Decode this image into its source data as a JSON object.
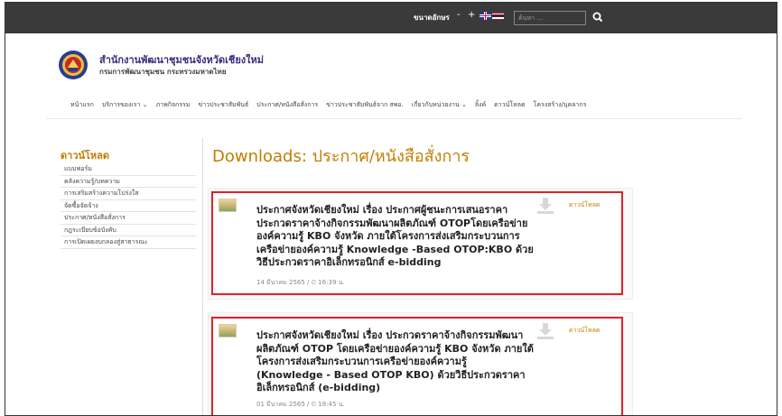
{
  "topbar": {
    "font_size_label": "ขนาดอักษร",
    "font_decrease": "-",
    "font_increase": "+",
    "search_placeholder": "ค้นหา ...",
    "languages": [
      "english-flag-icon",
      "thai-flag-icon"
    ]
  },
  "header": {
    "site_title": "สำนักงานพัฒนาชุมชนจังหวัดเชียงใหม่",
    "site_subtitle": "กรมการพัฒนาชุมชน กระทรวงมหาดไทย"
  },
  "nav": {
    "items": [
      "หน้าแรก",
      "บริการของเรา ⌄",
      "ภาพกิจกรรม",
      "ข่าวประชาสัมพันธ์",
      "ประกาศ/หนังสือสั่งการ",
      "ข่าวประชาสัมพันธ์จาก สพอ.",
      "เกี่ยวกับหน่วยงาน ⌄",
      "ลิ้งค์",
      "ดาวน์โหลด",
      "โครงสร้าง/บุคลากร"
    ]
  },
  "sidebar": {
    "title": "ดาวน์โหลด",
    "items": [
      "แบบฟอร์ม",
      "คลังความรู้/บทความ",
      "การเสริมสร้างความโปร่งใส",
      "จัดซื้อจัดจ้าง",
      "ประกาศ/หนังสือสั่งการ",
      "กฎระเบียบข้อบังคับ",
      "การเปิดเผยงบกลองสู่สาธารณะ"
    ]
  },
  "main": {
    "page_title": "Downloads: ประกาศ/หนังสือสั่งการ",
    "downloads": [
      {
        "title": "ประกาศจังหวัดเชียงใหม่ เรื่อง ประกาศผู้ชนะการเสนอราคา ประกวดราคาจ้างกิจกรรมพัฒนาผลิตภัณฑ์ OTOPโดยเครือข่ายองค์ความรู้ KBO จังหวัด ภายใต้โครงการส่งเสริมกระบวนการเครือข่ายองค์ความรู้ Knowledge -Based OTOP:KBO ด้วยวิธีประกวดราคาอิเล็กทรอนิกส์ e-bidding",
        "date": "14 มีนาคม 2565 / ⏲ 16:39 น.",
        "link_label": "ดาวน์โหลด"
      },
      {
        "title": "ประกาศจังหวัดเชียงใหม่ เรื่อง ประกวดราคาจ้างกิจกรรมพัฒนาผลิตภัณฑ์ OTOP โดยเครือข่ายองค์ความรู้ KBO จังหวัด ภายใต้โครงการส่งเสริมกระบวนการเครือข่ายองค์ความรู้ (Knowledge - Based OTOP KBO) ด้วยวิธีประกวดราคาอิเล็กทรอนิกส์ (e-bidding)",
        "date": "01 มีนาคม 2565 / ⏲ 18:45 น.",
        "link_label": "ดาวน์โหลด"
      }
    ]
  }
}
